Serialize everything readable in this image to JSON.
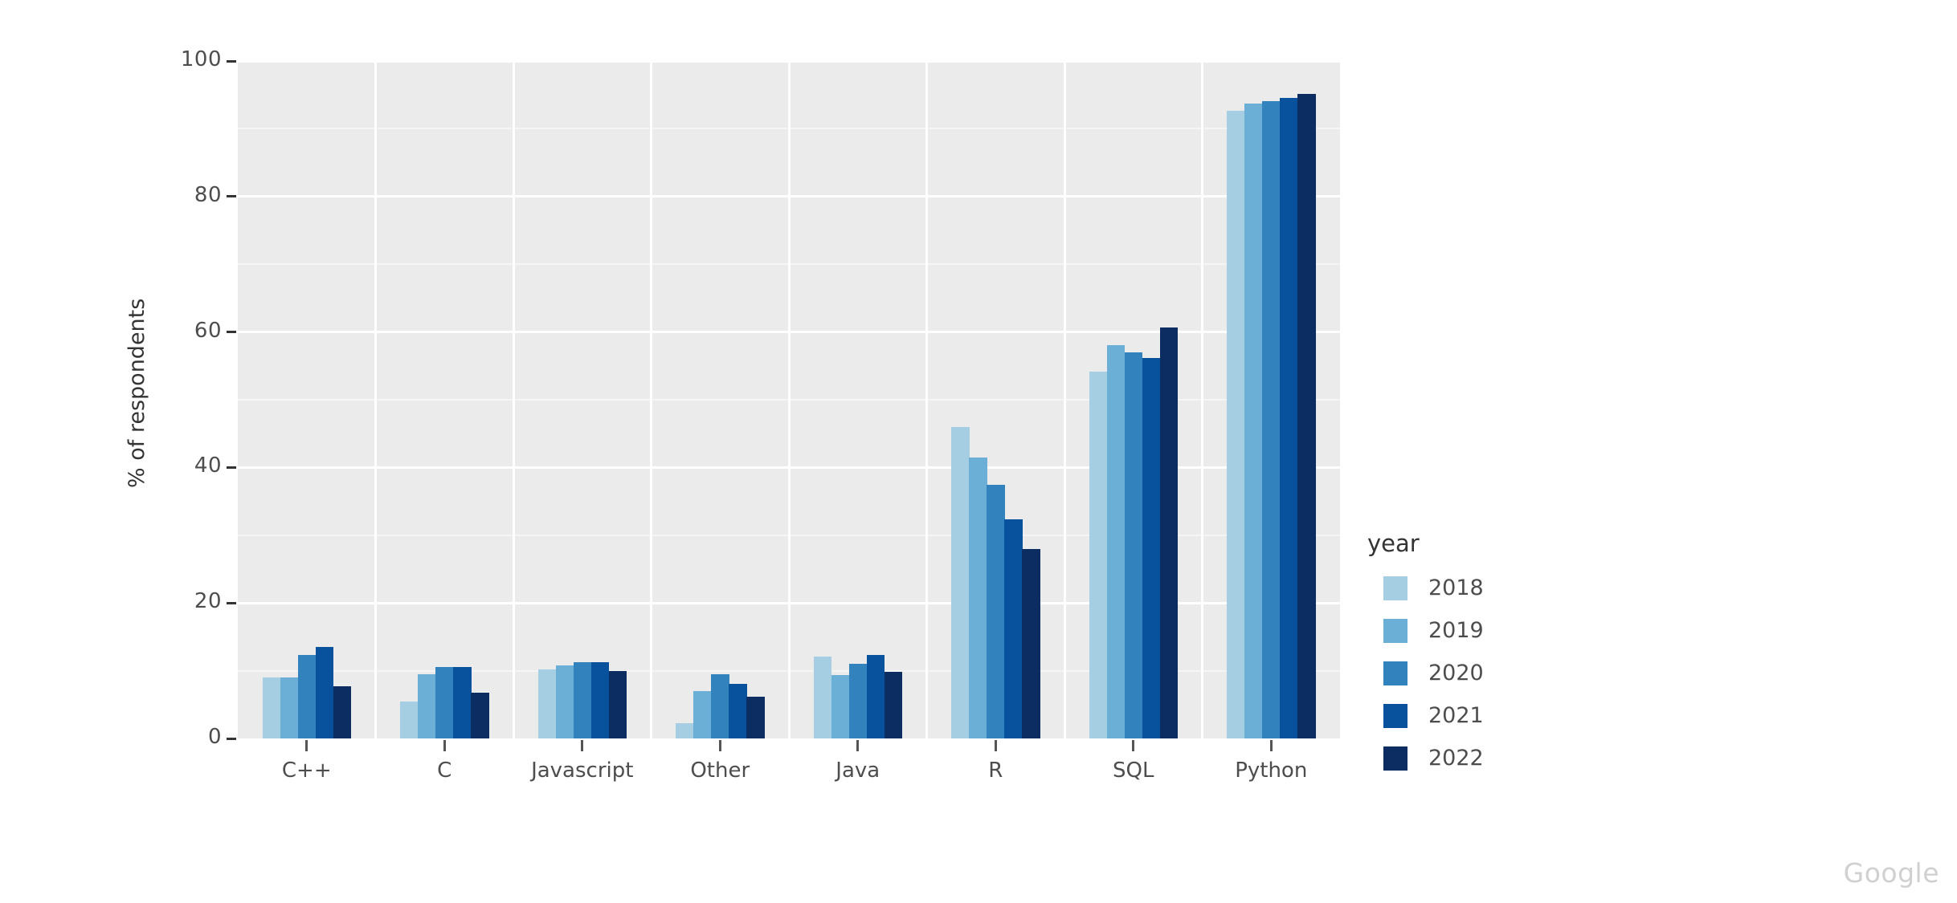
{
  "chart_data": {
    "type": "bar",
    "title": "",
    "subtitle": "",
    "xlabel": "",
    "ylabel": "% of respondents",
    "categories": [
      "C++",
      "C",
      "Javascript",
      "Other",
      "Java",
      "R",
      "SQL",
      "Python"
    ],
    "ylim": [
      0,
      100
    ],
    "yticks": [
      0,
      20,
      40,
      60,
      80,
      100
    ],
    "ytick_labels": [
      "0",
      "20",
      "40",
      "60",
      "80",
      "100"
    ],
    "grid": true,
    "legend_position": "right",
    "legend_title": "year",
    "series": [
      {
        "name": "2018",
        "color": "#a6cee3",
        "values": [
          9.0,
          5.5,
          10.2,
          2.2,
          12.1,
          46.0,
          54.2,
          92.7
        ]
      },
      {
        "name": "2019",
        "color": "#6baed6",
        "values": [
          9.0,
          9.5,
          10.8,
          7.0,
          9.4,
          41.5,
          58.0,
          93.7
        ]
      },
      {
        "name": "2020",
        "color": "#3182bd",
        "values": [
          12.3,
          10.5,
          11.2,
          9.5,
          11.0,
          37.5,
          57.0,
          94.1
        ]
      },
      {
        "name": "2021",
        "color": "#08519c",
        "values": [
          13.5,
          10.5,
          11.2,
          8.0,
          12.3,
          32.3,
          56.2,
          94.6
        ]
      },
      {
        "name": "2022",
        "color": "#0b2d61",
        "values": [
          7.7,
          6.7,
          9.9,
          6.2,
          9.8,
          28.0,
          60.7,
          95.2
        ]
      }
    ]
  },
  "watermark": {
    "text": "Google"
  },
  "colors": {
    "panel_background": "#ebebeb",
    "gridline_major": "#ffffff",
    "gridline_minor": "#f5f5f5",
    "axis_text": "#4d4d4d",
    "axis_title": "#333333"
  }
}
